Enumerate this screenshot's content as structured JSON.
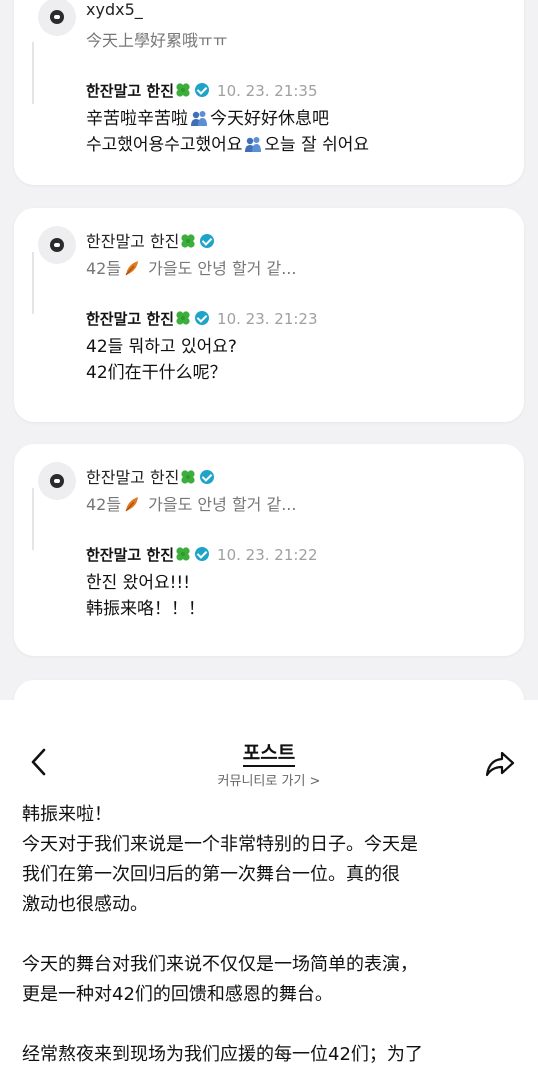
{
  "feed": {
    "cards": [
      {
        "quote_name": "xydx5_",
        "quote_text": "今天上學好累哦ㅠㅠ",
        "reply_name": "한잔말고 한진",
        "reply_time": "10. 23. 21:35",
        "line1_a": "辛苦啦辛苦啦",
        "line1_b": "今天好好休息吧",
        "line2_a": "수고했어용수고했어요",
        "line2_b": "오늘 잘 쉬어요"
      },
      {
        "quote_name": "한잔말고 한진",
        "quote_text_a": "42들",
        "quote_text_b": " 가을도 안녕 할거 같...",
        "reply_name": "한잔말고 한진",
        "reply_time": "10. 23. 21:23",
        "line1": "42들 뭐하고 있어요?",
        "line2": "42们在干什么呢？"
      },
      {
        "quote_name": "한잔말고 한진",
        "quote_text_a": "42들",
        "quote_text_b": " 가을도 안녕 할거 같...",
        "reply_name": "한잔말고 한진",
        "reply_time": "10. 23. 21:22",
        "line1": "한진 왔어요!!!",
        "line2": "韩振来咯！！！"
      }
    ]
  },
  "header": {
    "title": "포스트",
    "subtitle": "커뮤니티로 가기 >",
    "back_icon": "chevron-left-icon",
    "share_icon": "share-icon"
  },
  "post": {
    "lines": [
      "韩振来啦！",
      "今天对于我们来说是一个非常特别的日子。今天是",
      "我们在第一次回归后的第一次舞台一位。真的很",
      "激动也很感动。",
      "今天的舞台对我们来说不仅仅是一场简单的表演，",
      "更是一种对42们的回馈和感恩的舞台。",
      "经常熬夜来到现场为我们应援的每一位42们；为了"
    ]
  },
  "colors": {
    "feed_bg": "#f2f2f4",
    "verified": "#1fa4c9",
    "clover": "#3cae3c",
    "timestamp": "#a0a0a0"
  }
}
